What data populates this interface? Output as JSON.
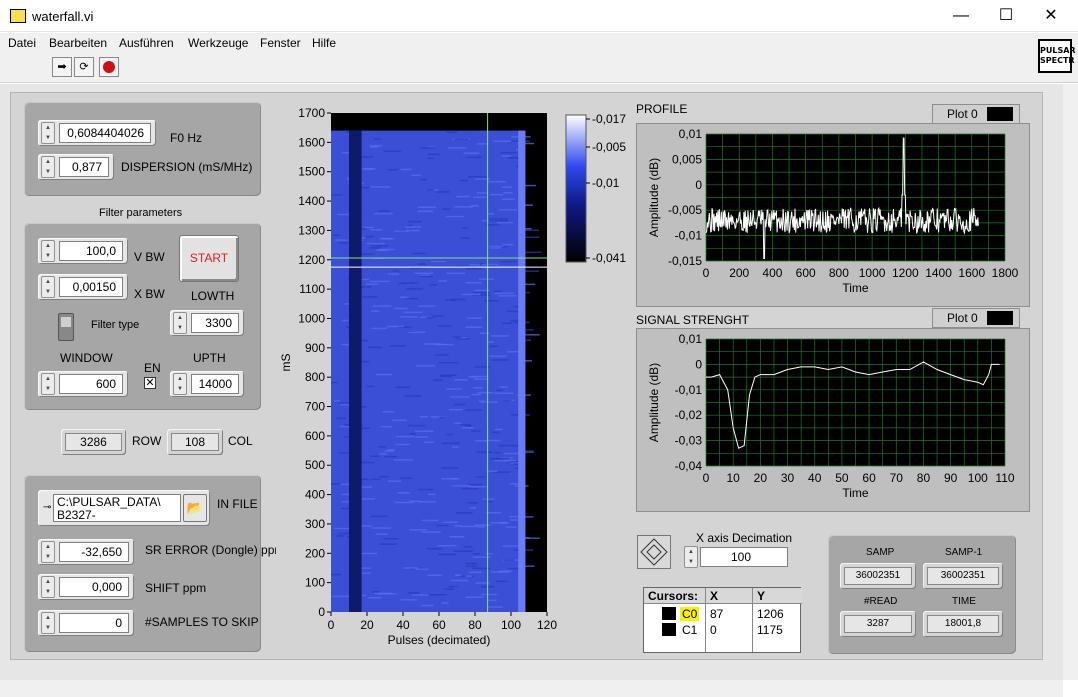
{
  "window": {
    "title": "waterfall.vi",
    "minimize_glyph": "—",
    "maximize_glyph": "☐",
    "close_glyph": "✕"
  },
  "menu": [
    "Datei",
    "Bearbeiten",
    "Ausführen",
    "Werkzeuge",
    "Fenster",
    "Hilfe"
  ],
  "toolbar": {
    "run_icon": "run-arrow-icon",
    "continuous_icon": "run-continuously-icon",
    "abort_icon": "abort-icon",
    "run_glyph": "➡",
    "continuous_glyph": "⟳"
  },
  "badge": "PULSAR SPECTR",
  "controls": {
    "f0": {
      "value": "0,6084404026",
      "label": "F0 Hz"
    },
    "dispersion": {
      "value": "0,877",
      "label": "DISPERSION (mS/MHz)"
    },
    "filter_title": "Filter parameters",
    "vbw": {
      "value": "100,0",
      "label": "V BW"
    },
    "xbw": {
      "value": "0,00150",
      "label": "X BW"
    },
    "start": "START",
    "lowth": {
      "value": "3300",
      "label": "LOWTH"
    },
    "filter_type": "Filter type",
    "window": {
      "value": "600",
      "label": "WINDOW"
    },
    "en": {
      "label": "EN",
      "checked": "✕"
    },
    "upth": {
      "value": "14000",
      "label": "UPTH"
    },
    "row": {
      "value": "3286",
      "label": "ROW"
    },
    "col": {
      "value": "108",
      "label": "COL"
    },
    "in_file": {
      "value": "C:\\PULSAR_DATA\\\nB2327-",
      "label": "IN FILE",
      "browse_glyph": "📂"
    },
    "sr_error": {
      "value": "-32,650",
      "label": "SR ERROR (Dongle) ppm"
    },
    "shift": {
      "value": "0,000",
      "label": "SHIFT ppm"
    },
    "skip": {
      "value": "0",
      "label": "#SAMPLES TO SKIP"
    },
    "x_decimation": {
      "value": "100",
      "label": "X axis Decimation"
    }
  },
  "indicators": {
    "samp": {
      "label": "SAMP",
      "value": "36002351"
    },
    "samp1": {
      "label": "SAMP-1",
      "value": "36002351"
    },
    "read": {
      "label": "#READ",
      "value": "3287"
    },
    "time": {
      "label": "TIME",
      "value": "18001,8"
    }
  },
  "cursors": {
    "headers": [
      "Cursors:",
      "X",
      "Y"
    ],
    "rows": [
      {
        "name": "C0",
        "x": "87",
        "y": "1206"
      },
      {
        "name": "C1",
        "x": "0",
        "y": "1175"
      }
    ]
  },
  "colors": {
    "waterfall_base": "#3a4fd6",
    "waterfall_dark": "#101a6a",
    "plot_bg": "#000000",
    "grid": "#1f7a1f",
    "trace": "#ffffff",
    "cursor": "#7fe57f"
  },
  "chart_data": [
    {
      "type": "heatmap",
      "xlabel": "Pulses (decimated)",
      "ylabel": "mS",
      "xlim": [
        0,
        120
      ],
      "ylim": [
        0,
        1700
      ],
      "xticks": [
        "0",
        "20",
        "40",
        "60",
        "80",
        "100",
        "120"
      ],
      "yticks": [
        "0",
        "100",
        "200",
        "300",
        "400",
        "500",
        "600",
        "700",
        "800",
        "900",
        "1000",
        "1100",
        "1200",
        "1300",
        "1400",
        "1500",
        "1600",
        "1700"
      ],
      "data_extent": {
        "x": [
          0,
          108
        ],
        "y": [
          0,
          1640
        ]
      },
      "dark_band_x": [
        10,
        17
      ],
      "cursor_x": 87,
      "cursor_y": [
        1206,
        1175
      ],
      "colorbar": {
        "ticks": [
          "-0,017",
          "-0,005",
          "-0,01",
          "-0,041"
        ],
        "range": [
          -0.041,
          -0.017
        ]
      }
    },
    {
      "type": "line",
      "title": "PROFILE",
      "legend": "Plot 0",
      "xlabel": "Time",
      "ylabel": "Amplitude (dB)",
      "xlim": [
        0,
        1800
      ],
      "ylim": [
        -0.015,
        0.01
      ],
      "xticks": [
        "0",
        "200",
        "400",
        "600",
        "800",
        "1000",
        "1200",
        "1400",
        "1600",
        "1800"
      ],
      "yticks": [
        "0,01",
        "0,005",
        "0",
        "-0,005",
        "-0,01",
        "-0,015"
      ],
      "series": [
        {
          "x_range": [
            0,
            1640
          ],
          "baseline": -0.007,
          "noise": 0.0025,
          "spike_x": 1190,
          "spike_y": 0.0092,
          "dip_x": 350,
          "dip_y": -0.0145
        }
      ]
    },
    {
      "type": "line",
      "title": "SIGNAL STRENGHT",
      "legend": "Plot 0",
      "xlabel": "Time",
      "ylabel": "Amplitude (dB)",
      "xlim": [
        0,
        110
      ],
      "ylim": [
        -0.04,
        0.01
      ],
      "xticks": [
        "0",
        "10",
        "20",
        "30",
        "40",
        "50",
        "60",
        "70",
        "80",
        "90",
        "100",
        "110"
      ],
      "yticks": [
        "0,01",
        "0",
        "-0,01",
        "-0,02",
        "-0,03",
        "-0,04"
      ],
      "series": [
        {
          "x": [
            0,
            2,
            5,
            8,
            10,
            12,
            14,
            16,
            18,
            20,
            25,
            30,
            35,
            40,
            45,
            50,
            55,
            60,
            65,
            70,
            75,
            80,
            85,
            90,
            95,
            100,
            102,
            104,
            105,
            108
          ],
          "y": [
            -0.005,
            -0.005,
            -0.004,
            -0.01,
            -0.025,
            -0.033,
            -0.032,
            -0.012,
            -0.005,
            -0.004,
            -0.004,
            -0.002,
            -0.001,
            -0.001,
            -0.002,
            -0.001,
            -0.003,
            -0.004,
            -0.003,
            -0.002,
            -0.002,
            0.001,
            -0.002,
            -0.004,
            -0.006,
            -0.007,
            -0.008,
            -0.004,
            0,
            0
          ]
        }
      ]
    }
  ]
}
